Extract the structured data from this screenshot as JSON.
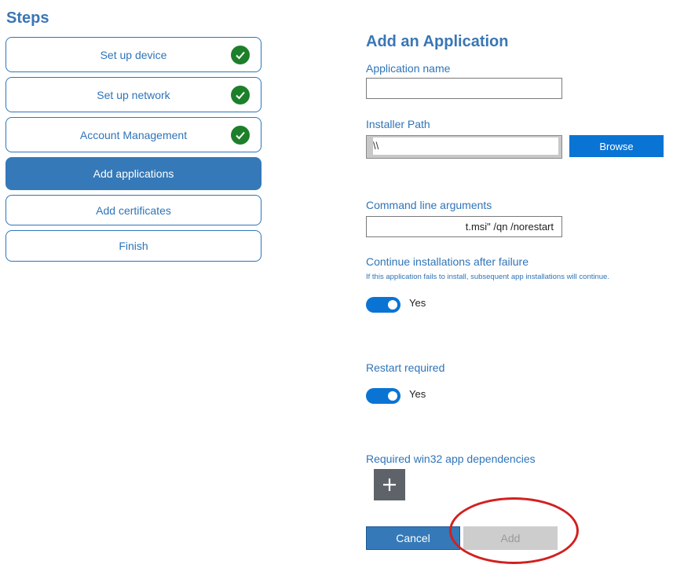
{
  "steps": {
    "title": "Steps",
    "items": [
      {
        "label": "Set up device",
        "completed": true
      },
      {
        "label": "Set up network",
        "completed": true
      },
      {
        "label": "Account Management",
        "completed": true
      },
      {
        "label": "Add applications",
        "active": true
      },
      {
        "label": "Add certificates"
      },
      {
        "label": "Finish"
      }
    ]
  },
  "form": {
    "title": "Add an Application",
    "app_name_label": "Application name",
    "app_name_value": "",
    "installer_path_label": "Installer Path",
    "installer_path_value": "\\\\",
    "browse_label": "Browse",
    "cmd_args_label": "Command line arguments",
    "cmd_args_value": "t.msi\" /qn /norestart",
    "continue_label": "Continue installations after failure",
    "continue_desc": "If this application fails to install, subsequent app installations will continue.",
    "continue_toggle_label": "Yes",
    "continue_toggle_on": true,
    "restart_label": "Restart required",
    "restart_toggle_label": "Yes",
    "restart_toggle_on": true,
    "dependencies_label": "Required win32 app dependencies",
    "cancel_label": "Cancel",
    "add_label": "Add"
  },
  "colors": {
    "accent": "#3579b8",
    "primary_button": "#0a74d4",
    "check": "#1c7f2a",
    "annotation": "#d22020"
  }
}
